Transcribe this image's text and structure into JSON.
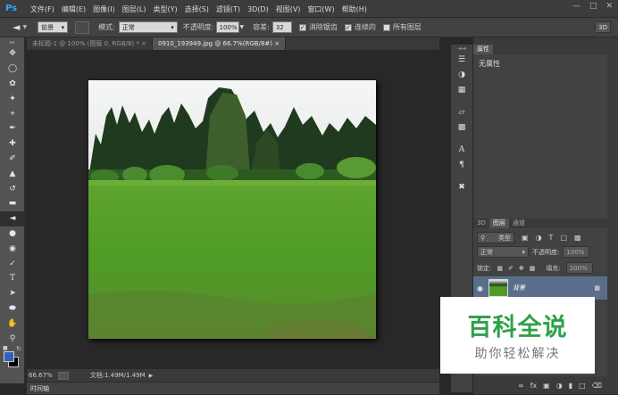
{
  "app": {
    "logo": "Ps"
  },
  "menu": [
    "文件(F)",
    "编辑(E)",
    "图像(I)",
    "图层(L)",
    "类型(Y)",
    "选择(S)",
    "滤镜(T)",
    "3D(D)",
    "视图(V)",
    "窗口(W)",
    "帮助(H)"
  ],
  "options": {
    "fill_source": "前景",
    "mode_label": "模式:",
    "mode_value": "正常",
    "opacity_label": "不透明度:",
    "opacity_value": "100%",
    "tolerance_label": "容差:",
    "tolerance_value": "32",
    "antialias_label": "消除锯齿",
    "contiguous_label": "连续的",
    "all_layers_label": "所有图层",
    "workspace_3d": "3D"
  },
  "tabs": [
    {
      "label": "未标题-1 @ 100% (图层 0, RGB/8) *"
    },
    {
      "label": "0910_193949.jpg @ 66.7%(RGB/8#)"
    }
  ],
  "status": {
    "zoom": "66.67%",
    "doc": "文档:1.49M/1.49M"
  },
  "timeline": {
    "label": "时间轴"
  },
  "properties": {
    "tab": "属性",
    "content": "无属性"
  },
  "layers": {
    "tabs": [
      "3D",
      "图层",
      "通道"
    ],
    "filter_kind": "类型",
    "blend_mode": "正常",
    "opacity_label": "不透明度:",
    "opacity_value": "100%",
    "lock_label": "锁定:",
    "fill_label": "填充:",
    "fill_value": "100%",
    "layer_name": "背景"
  },
  "watermark": {
    "title": "百科全说",
    "subtitle": "助你轻松解决"
  },
  "colors": {
    "accent": "#31a8ff",
    "watermark_green": "#2ea14a",
    "layer_selected": "#5a6e8c"
  }
}
